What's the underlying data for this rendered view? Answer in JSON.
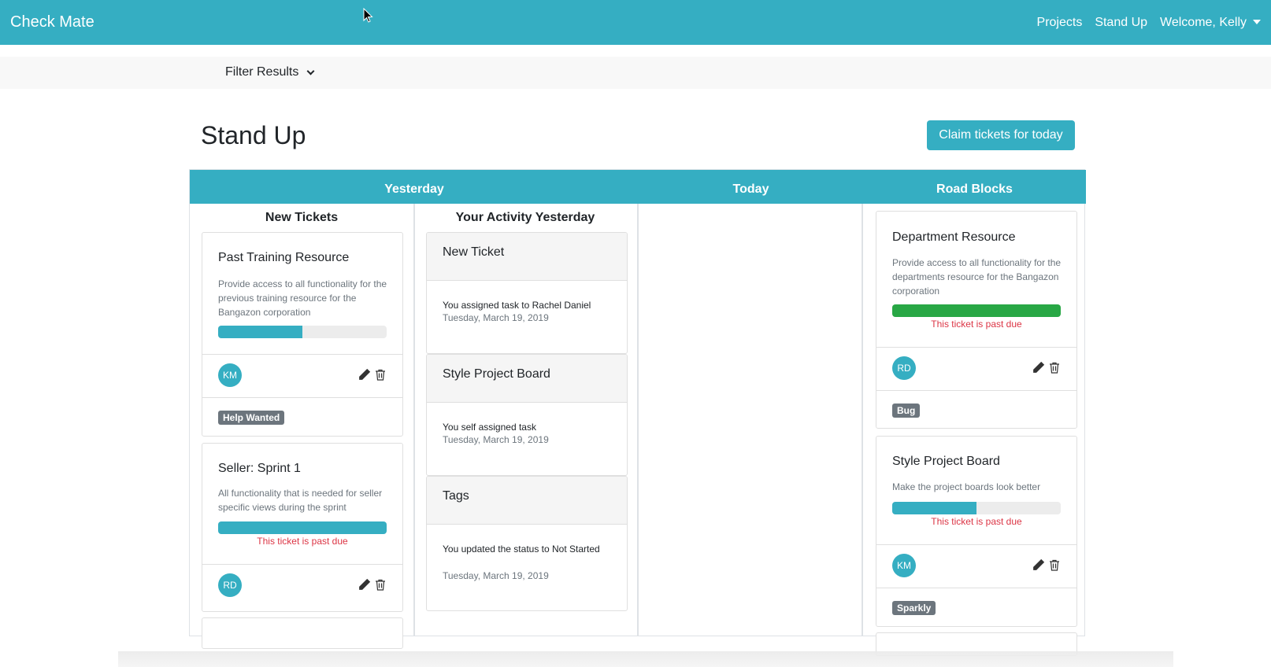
{
  "navbar": {
    "brand": "Check Mate",
    "links": [
      "Projects",
      "Stand Up"
    ],
    "user_menu": "Welcome, Kelly"
  },
  "filter": {
    "label": "Filter Results"
  },
  "page": {
    "title": "Stand Up",
    "claim_button": "Claim tickets for today"
  },
  "board": {
    "headers": [
      "Yesterday",
      "Today",
      "Road Blocks"
    ],
    "new_tickets": {
      "title": "New Tickets",
      "cards": [
        {
          "title": "Past Training Resource",
          "description": "Provide access to all functionality for the previous training resource for the Bangazon corporation",
          "progress": 0.5,
          "progress_color": "#35aec2",
          "past_due": "",
          "assignee": "KM",
          "tag": "Help Wanted"
        },
        {
          "title": "Seller: Sprint 1",
          "description": "All functionality that is needed for seller specific views during the sprint",
          "progress": 1.0,
          "progress_color": "#35aec2",
          "past_due": "This ticket is past due",
          "assignee": "RD",
          "tag": ""
        }
      ]
    },
    "activity": {
      "title": "Your Activity Yesterday",
      "items": [
        {
          "ticket": "New Ticket",
          "text": "You assigned task to Rachel Daniel",
          "date": "Tuesday, March 19, 2019"
        },
        {
          "ticket": "Style Project Board",
          "text": "You self assigned task",
          "date": "Tuesday, March 19, 2019"
        },
        {
          "ticket": "Tags",
          "text": "You updated the status to Not Started",
          "date": "Tuesday, March 19, 2019"
        }
      ]
    },
    "road_blocks": {
      "cards": [
        {
          "title": "Department Resource",
          "description": "Provide access to all functionality for the departments resource for the Bangazon corporation",
          "progress": 1.0,
          "progress_color": "#28a745",
          "past_due": "This ticket is past due",
          "assignee": "RD",
          "tag": "Bug"
        },
        {
          "title": "Style Project Board",
          "description": "Make the project boards look better",
          "progress": 0.5,
          "progress_color": "#35aec2",
          "past_due": "This ticket is past due",
          "assignee": "KM",
          "tag": "Sparkly"
        }
      ]
    }
  },
  "colors": {
    "primary": "#35aec2",
    "success": "#28a745",
    "danger": "#dc3545",
    "badge": "#6c757d"
  },
  "icons": [
    "pencil-icon",
    "trash-icon",
    "caret-down-icon",
    "chevron-down-icon",
    "mouse-cursor"
  ]
}
